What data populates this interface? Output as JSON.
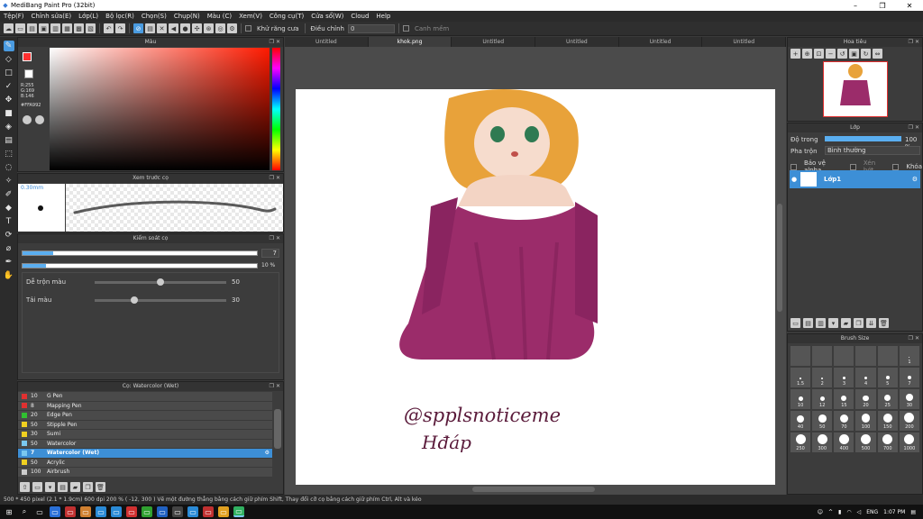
{
  "window": {
    "title": "MediBang Paint Pro (32bit)",
    "min": "–",
    "max": "❐",
    "close": "✕"
  },
  "menu": [
    "Tệp(F)",
    "Chỉnh sửa(E)",
    "Lớp(L)",
    "Bộ lọc(R)",
    "Chọn(S)",
    "Chụp(N)",
    "Màu (C)",
    "Xem(V)",
    "Công cụ(T)",
    "Cửa sổ(W)",
    "Cloud",
    "Help"
  ],
  "toolbar": {
    "antialias": "Khử răng cưa",
    "adjust": "Điều chỉnh",
    "adjust_value": "0",
    "snap": "Canh mềm"
  },
  "color_panel": {
    "title": "Màu",
    "r": "R:255",
    "g": "G:169",
    "b": "B:146",
    "hex": "#FFA992",
    "accent": "#ff3030"
  },
  "brush_preview": {
    "title": "Xem trước cọ",
    "size": "0.30mm"
  },
  "brush_control": {
    "title": "Kiểm soát cọ",
    "size_value": "7",
    "opacity_value": "10 %",
    "blend_label": "Dễ trộn màu",
    "blend_value": "50",
    "reload_label": "Tải màu",
    "reload_value": "30",
    "size_fill": 0.13,
    "opacity_fill": 0.1,
    "blend_pos": 0.5,
    "reload_pos": 0.3
  },
  "brush_list": {
    "title": "Cọ: Watercolor (Wet)",
    "items": [
      {
        "num": "10",
        "name": "G Pen",
        "color": "#e03030"
      },
      {
        "num": "8",
        "name": "Mapping Pen",
        "color": "#e03030"
      },
      {
        "num": "20",
        "name": "Edge Pen",
        "color": "#30c030"
      },
      {
        "num": "50",
        "name": "Stipple Pen",
        "color": "#f0d020"
      },
      {
        "num": "30",
        "name": "Sumi",
        "color": "#f0d020"
      },
      {
        "num": "50",
        "name": "Watercolor",
        "color": "#7ac8f0"
      },
      {
        "num": "7",
        "name": "Watercolor (Wet)",
        "color": "#7ac8f0"
      },
      {
        "num": "50",
        "name": "Acrylic",
        "color": "#f0d020"
      },
      {
        "num": "100",
        "name": "Airbrush",
        "color": "#cccccc"
      }
    ]
  },
  "tabs": [
    "Untitled",
    "khok.png",
    "Untitled",
    "Untitled",
    "Untitled",
    "Untitled"
  ],
  "navigator": {
    "title": "Hoa tiêu"
  },
  "layer_panel": {
    "title": "Lớp",
    "opacity_label": "Độ trong",
    "opacity_value": "100 %",
    "blend_label": "Pha trộn",
    "blend_value": "Bình thường",
    "protect_alpha": "Bảo vệ alpha",
    "clipping": "Xén bớt",
    "lock": "Khóa",
    "layer_name": "Lớp1"
  },
  "brush_size": {
    "title": "Brush Size",
    "sizes": [
      "1",
      "1.5",
      "2",
      "3",
      "4",
      "5",
      "7",
      "10",
      "12",
      "15",
      "20",
      "25",
      "30",
      "40",
      "50",
      "70",
      "100",
      "150",
      "200",
      "250",
      "300",
      "400",
      "500",
      "700",
      "1000"
    ],
    "blank_count": 5
  },
  "artwork": {
    "signature_line1": "@spplsnoticeme",
    "signature_line2": "Hđáp"
  },
  "status": {
    "text": "500 * 450 pixel   (2.1 * 1.9cm)   600 dpi   200 %   ( -12, 300 )   Vẽ một đường thẳng bằng cách giữ phím Shift, Thay đổi cỡ cọ bằng cách giữ phím Ctrl, Alt và kéo"
  },
  "taskbar": {
    "lang": "ENG",
    "time": "1:07 PM"
  }
}
